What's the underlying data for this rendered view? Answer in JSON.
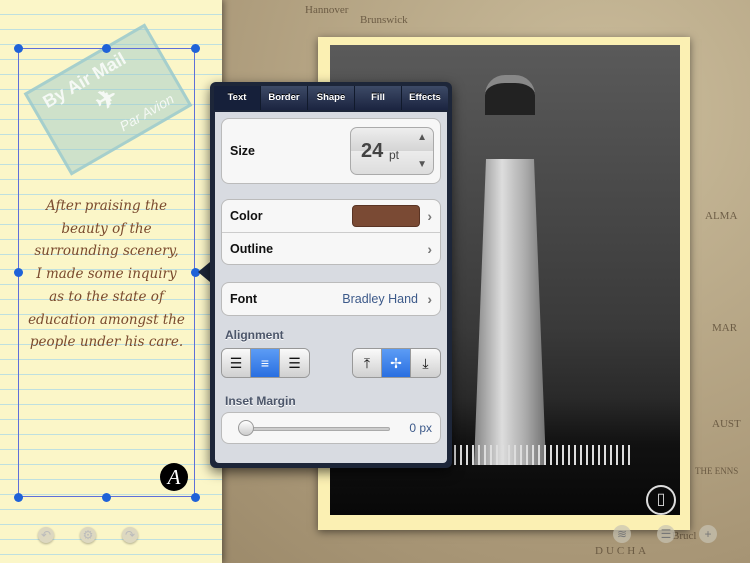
{
  "map_labels": [
    "Hannover",
    "Brunswick",
    "THE ENNS",
    "Brucl",
    "DUCHA",
    "ALMA",
    "MAR",
    "AUST"
  ],
  "note": {
    "stamp_top": "By Air Mail",
    "stamp_bottom": "Par Avion",
    "text_lines": [
      "After praising the",
      "beauty of the",
      "surrounding scenery,",
      "I made some inquiry",
      "as to the state of",
      "education amongst the",
      "people under his care."
    ],
    "text_color": "#7a4a2e",
    "badge": "A",
    "toolbar_icons": [
      "undo-icon",
      "gear-icon",
      "redo-icon"
    ]
  },
  "popover": {
    "tabs": [
      "Text",
      "Border",
      "Shape",
      "Fill",
      "Effects"
    ],
    "active_tab": "Text",
    "size_label": "Size",
    "size_value": "24",
    "size_unit": "pt",
    "color_label": "Color",
    "color_value": "#7a4a34",
    "outline_label": "Outline",
    "font_label": "Font",
    "font_value": "Bradley Hand",
    "alignment_label": "Alignment",
    "horizontal_alignment": "center",
    "vertical_alignment": "middle",
    "inset_label": "Inset Margin",
    "inset_value": "0 px",
    "inset_fraction": 0
  },
  "photo": {
    "overlay_icon": "film-icon"
  },
  "bottom_icons": [
    "layers-icon",
    "list-icon",
    "add-icon"
  ]
}
